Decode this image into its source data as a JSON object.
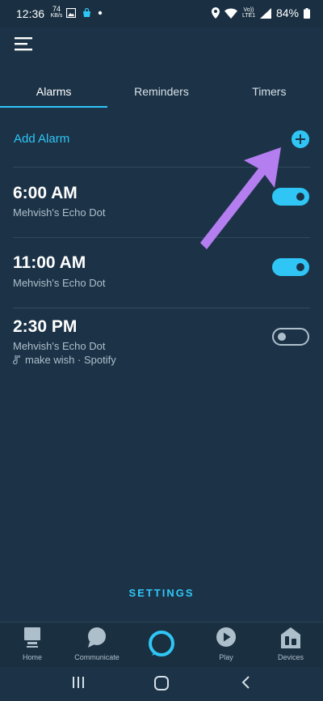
{
  "status_bar": {
    "time": "12:36",
    "speed_value": "74",
    "speed_unit": "KB/s",
    "volte_top": "Vo))",
    "volte_bottom": "LTE1",
    "battery": "84%"
  },
  "tabs": [
    {
      "label": "Alarms",
      "active": true
    },
    {
      "label": "Reminders",
      "active": false
    },
    {
      "label": "Timers",
      "active": false
    }
  ],
  "add_alarm": {
    "label": "Add Alarm"
  },
  "alarms": [
    {
      "time": "6:00 AM",
      "device": "Mehvish's Echo Dot",
      "enabled": true
    },
    {
      "time": "11:00 AM",
      "device": "Mehvish's Echo Dot",
      "enabled": true
    },
    {
      "time": "2:30 PM",
      "device": "Mehvish's Echo Dot",
      "music": "make wish · Spotify",
      "enabled": false
    }
  ],
  "settings_label": "SETTINGS",
  "bottom_nav": [
    {
      "label": "Home"
    },
    {
      "label": "Communicate"
    },
    {
      "label": ""
    },
    {
      "label": "Play"
    },
    {
      "label": "Devices"
    }
  ],
  "colors": {
    "background": "#1c3347",
    "accent": "#2fc6f6",
    "secondary_text": "#aebfcc",
    "annotation_arrow": "#b57ef0"
  }
}
